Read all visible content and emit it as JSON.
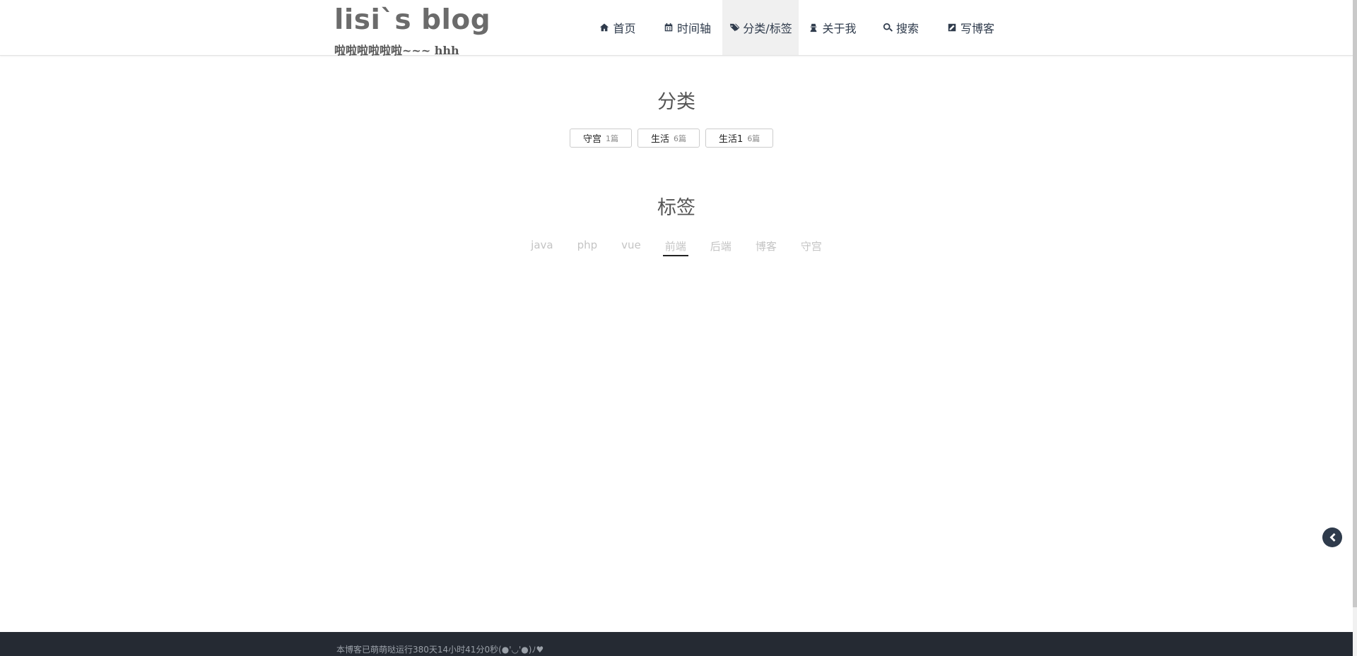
{
  "brand": {
    "title": "lisi`s blog",
    "subtitle": "啦啦啦啦啦啦~~~ hhh"
  },
  "nav": {
    "items": [
      {
        "label": "首页",
        "icon": "home-icon"
      },
      {
        "label": "时间轴",
        "icon": "calendar-icon"
      },
      {
        "label": "分类/标签",
        "icon": "tags-icon",
        "active": true
      },
      {
        "label": "关于我",
        "icon": "user-secret-icon"
      },
      {
        "label": "搜索",
        "icon": "search-icon"
      },
      {
        "label": "写博客",
        "icon": "edit-icon"
      }
    ]
  },
  "categories": {
    "title": "分类",
    "items": [
      {
        "name": "守宫",
        "count": "1篇"
      },
      {
        "name": "生活",
        "count": "6篇"
      },
      {
        "name": "生活1",
        "count": "6篇"
      }
    ]
  },
  "tags": {
    "title": "标签",
    "items": [
      "java",
      "php",
      "vue",
      "前端",
      "后端",
      "博客",
      "守宫"
    ],
    "active_index": 3
  },
  "footer": {
    "text": "本博客已萌萌哒运行380天14小时41分0秒(●'◡'●)ﾉ♥"
  },
  "colors": {
    "nav_text": "#2f3b4c",
    "footer_bg": "#252a33",
    "tag_inactive": "#c4c4c4"
  }
}
